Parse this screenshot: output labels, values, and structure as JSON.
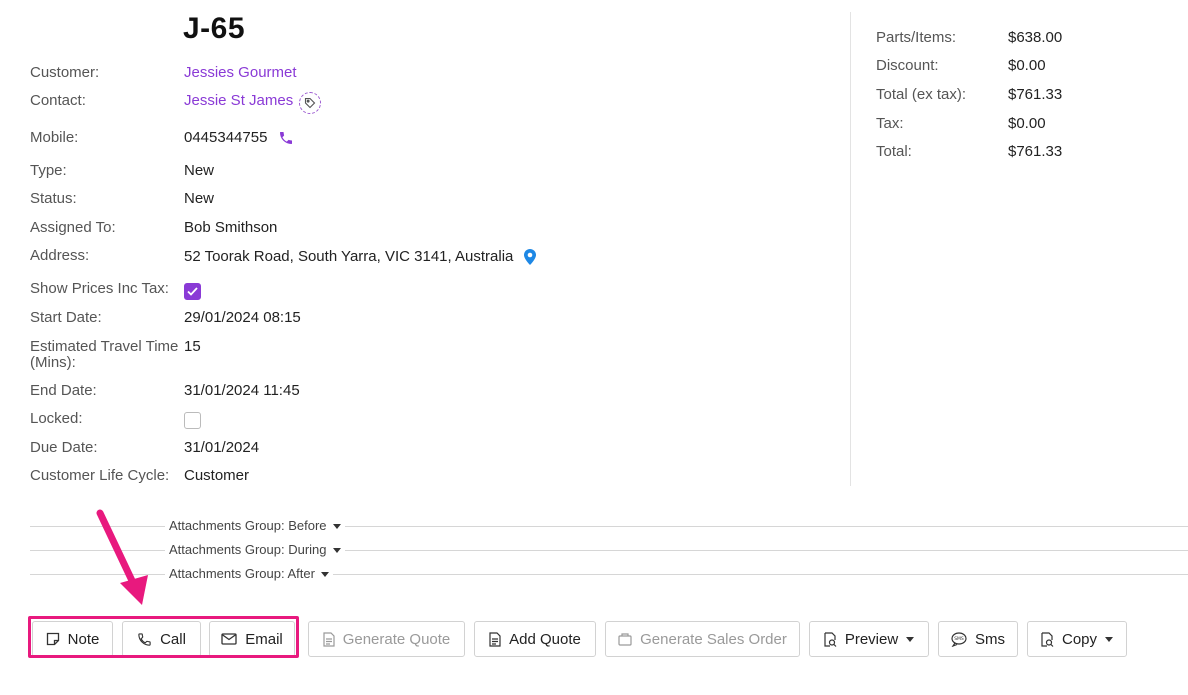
{
  "job": {
    "title": "J-65",
    "fields": [
      {
        "label": "Customer:",
        "value": "Jessies Gourmet"
      },
      {
        "label": "Contact:",
        "value": "Jessie St James"
      },
      {
        "label": "Mobile:",
        "value": "0445344755"
      },
      {
        "label": "Type:",
        "value": "New"
      },
      {
        "label": "Status:",
        "value": "New"
      },
      {
        "label": "Assigned To:",
        "value": "Bob Smithson"
      },
      {
        "label": "Address:",
        "value": "52 Toorak Road, South Yarra, VIC 3141, Australia"
      },
      {
        "label": "Show Prices Inc Tax:",
        "value": true
      },
      {
        "label": "Start Date:",
        "value": "29/01/2024 08:15"
      },
      {
        "label": "Estimated Travel Time (Mins):",
        "value": "15"
      },
      {
        "label": "End Date:",
        "value": "31/01/2024 11:45"
      },
      {
        "label": "Locked:",
        "value": false
      },
      {
        "label": "Due Date:",
        "value": "31/01/2024"
      },
      {
        "label": "Customer Life Cycle:",
        "value": "Customer"
      }
    ]
  },
  "totals": [
    {
      "label": "Parts/Items:",
      "value": "$638.00"
    },
    {
      "label": "Discount:",
      "value": "$0.00"
    },
    {
      "label": "Total (ex tax):",
      "value": "$761.33"
    },
    {
      "label": "Tax:",
      "value": "$0.00"
    },
    {
      "label": "Total:",
      "value": "$761.33"
    }
  ],
  "attachment_groups": [
    {
      "label": "Attachments Group: Before"
    },
    {
      "label": "Attachments Group: During"
    },
    {
      "label": "Attachments Group: After"
    }
  ],
  "actions": {
    "note": "Note",
    "call": "Call",
    "email": "Email",
    "generate_quote": "Generate Quote",
    "add_quote": "Add Quote",
    "generate_sales_order": "Generate Sales Order",
    "preview": "Preview",
    "sms": "Sms",
    "copy": "Copy"
  },
  "icons": {
    "tag": "tag-icon",
    "phone": "phone-icon",
    "map": "map-pin-icon",
    "note": "note-icon",
    "call": "phone-icon",
    "email": "envelope-icon",
    "document": "document-icon",
    "preview": "preview-icon",
    "sms": "sms-bubble-icon",
    "copy": "copy-icon"
  },
  "colors": {
    "link": "#8a3ad6",
    "highlight": "#e8197e",
    "map_icon": "#1e88e5"
  }
}
